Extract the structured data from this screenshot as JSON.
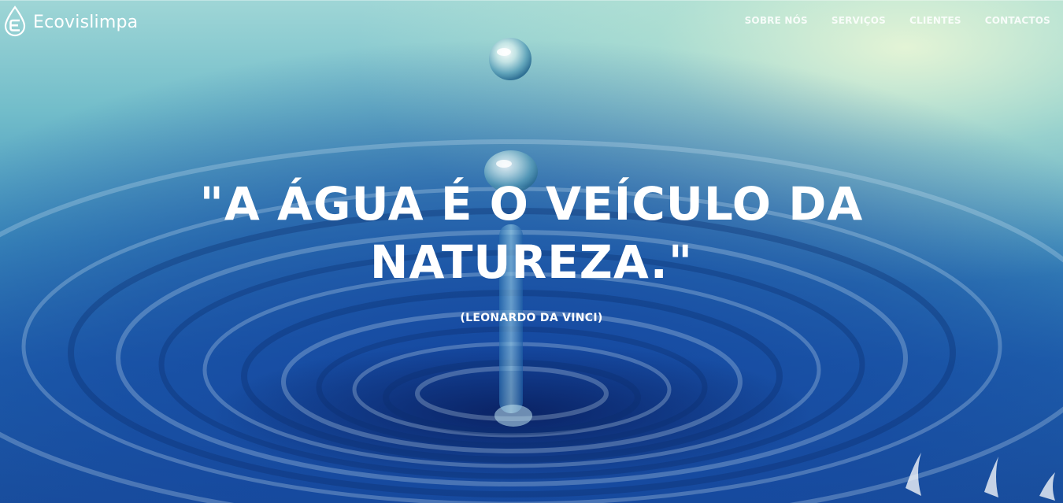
{
  "brand": {
    "name": "Ecovislimpa",
    "logo_icon": "water-drop-e-icon"
  },
  "nav": {
    "items": [
      {
        "label": "SOBRE NÓS"
      },
      {
        "label": "SERVIÇOS"
      },
      {
        "label": "CLIENTES"
      },
      {
        "label": "CONTACTOS"
      }
    ]
  },
  "hero": {
    "quote_line1": "\"A ÁGUA É O VEÍCULO DA",
    "quote_line2": "NATUREZA.\"",
    "author": "(LEONARDO DA VINCI)",
    "background_image": "water-drop-ripple-image"
  },
  "colors": {
    "text": "#ffffff",
    "water_deep": "#1a4f9c",
    "water_light": "#9fd6d6",
    "glow": "#e8f6d6"
  }
}
